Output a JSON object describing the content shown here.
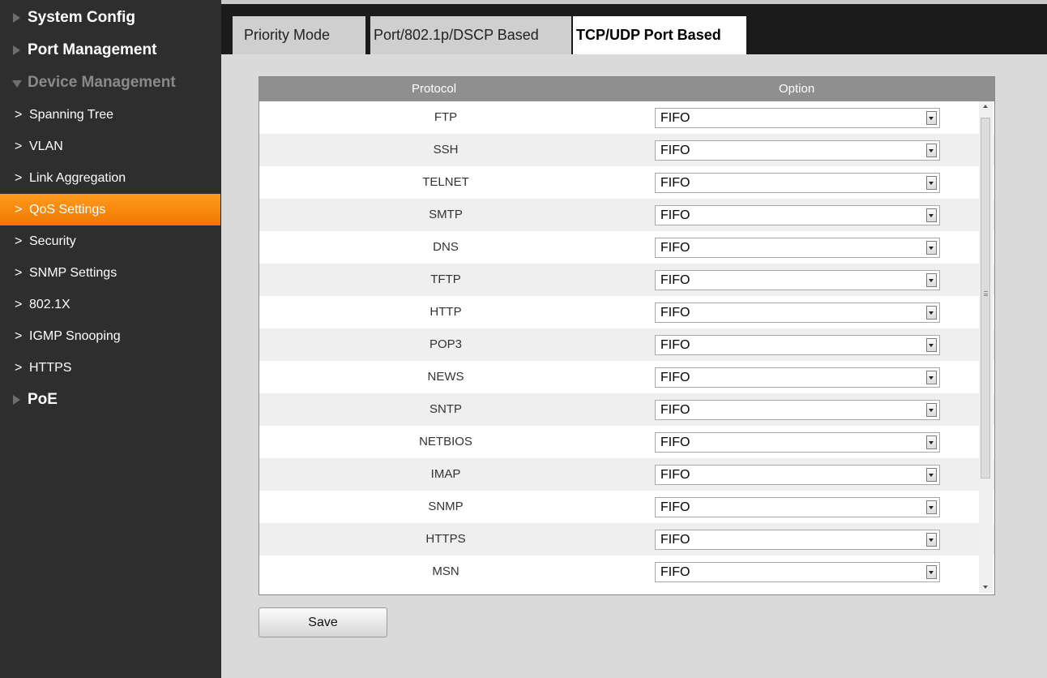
{
  "sidebar": {
    "sections": [
      {
        "label": "System Config"
      },
      {
        "label": "Port Management"
      },
      {
        "label": "Device Management"
      },
      {
        "label": "PoE"
      }
    ],
    "device_items": [
      {
        "label": "Spanning Tree"
      },
      {
        "label": "VLAN"
      },
      {
        "label": "Link Aggregation"
      },
      {
        "label": "QoS Settings"
      },
      {
        "label": "Security"
      },
      {
        "label": "SNMP Settings"
      },
      {
        "label": "802.1X"
      },
      {
        "label": "IGMP Snooping"
      },
      {
        "label": "HTTPS"
      }
    ],
    "chevron": ">",
    "active_item": "QoS Settings",
    "active_color": "#f58a0c"
  },
  "tabs": [
    {
      "label": "Priority Mode"
    },
    {
      "label": "Port/802.1p/DSCP Based"
    },
    {
      "label": "TCP/UDP Port Based"
    }
  ],
  "active_tab": "TCP/UDP Port Based",
  "table": {
    "headers": {
      "protocol": "Protocol",
      "option": "Option"
    },
    "rows": [
      {
        "protocol": "FTP",
        "option": "FIFO"
      },
      {
        "protocol": "SSH",
        "option": "FIFO"
      },
      {
        "protocol": "TELNET",
        "option": "FIFO"
      },
      {
        "protocol": "SMTP",
        "option": "FIFO"
      },
      {
        "protocol": "DNS",
        "option": "FIFO"
      },
      {
        "protocol": "TFTP",
        "option": "FIFO"
      },
      {
        "protocol": "HTTP",
        "option": "FIFO"
      },
      {
        "protocol": "POP3",
        "option": "FIFO"
      },
      {
        "protocol": "NEWS",
        "option": "FIFO"
      },
      {
        "protocol": "SNTP",
        "option": "FIFO"
      },
      {
        "protocol": "NETBIOS",
        "option": "FIFO"
      },
      {
        "protocol": "IMAP",
        "option": "FIFO"
      },
      {
        "protocol": "SNMP",
        "option": "FIFO"
      },
      {
        "protocol": "HTTPS",
        "option": "FIFO"
      },
      {
        "protocol": "MSN",
        "option": "FIFO"
      }
    ]
  },
  "save_label": "Save",
  "icons": {
    "section_collapsed": "triangle-right-icon",
    "section_expanded": "triangle-down-icon",
    "dropdown": "dropdown-arrow-icon"
  }
}
